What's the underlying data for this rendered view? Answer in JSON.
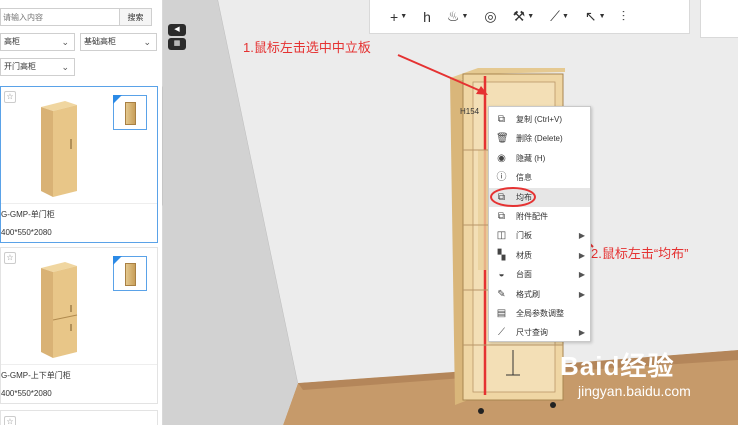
{
  "search": {
    "placeholder": "请输入内容",
    "button": "搜索"
  },
  "filters": {
    "category": "高柜",
    "subcategory": "基础高柜",
    "type": "开门高柜"
  },
  "products": [
    {
      "name": "G-GMP-单门柜",
      "size": "400*550*2080",
      "selected": true
    },
    {
      "name": "G-GMP-上下单门柜",
      "size": "400*550*2080",
      "selected": false
    }
  ],
  "side_tabs": [
    "◀",
    "▦"
  ],
  "toolbar": {
    "icons": [
      "plus-icon",
      "measure-icon",
      "paint-bucket-icon",
      "palette-icon",
      "roller-icon",
      "ruler-icon",
      "cursor-icon",
      "sliders-icon"
    ],
    "glyphs": [
      "+",
      "h",
      "♨",
      "◎",
      "⚒",
      "⟋",
      "↖",
      "⫶"
    ]
  },
  "annotations": {
    "step1": "1.鼠标左击选中中立板",
    "step2": "2.鼠标左击“均布”"
  },
  "cabinet_label": "154",
  "context_menu": [
    {
      "label": "复制 (Ctrl+V)",
      "icon": "copy-icon",
      "glyph": "⧉",
      "submenu": false
    },
    {
      "label": "删除 (Delete)",
      "icon": "trash-icon",
      "glyph": "🗑",
      "submenu": false
    },
    {
      "label": "隐藏 (H)",
      "icon": "eye-icon",
      "glyph": "◉",
      "submenu": false
    },
    {
      "label": "信息",
      "icon": "info-icon",
      "glyph": "ⓘ",
      "submenu": false
    },
    {
      "label": "均布",
      "icon": "distribute-icon",
      "glyph": "⧉",
      "submenu": false,
      "hover": true
    },
    {
      "label": "附件配件",
      "icon": "accessory-icon",
      "glyph": "⧉",
      "submenu": false
    },
    {
      "label": "门板",
      "icon": "door-icon",
      "glyph": "◫",
      "submenu": true
    },
    {
      "label": "材质",
      "icon": "material-icon",
      "glyph": "▚",
      "submenu": true
    },
    {
      "label": "台面",
      "icon": "countertop-icon",
      "glyph": "◒",
      "submenu": true
    },
    {
      "label": "格式刷",
      "icon": "brush-icon",
      "glyph": "✎",
      "submenu": true
    },
    {
      "label": "全局参数调整",
      "icon": "settings-doc-icon",
      "glyph": "▤",
      "submenu": false
    },
    {
      "label": "尺寸查询",
      "icon": "ruler-icon",
      "glyph": "⟋",
      "submenu": true
    }
  ],
  "watermark": {
    "brand": "Baid经验",
    "url": "jingyan.baidu.com"
  }
}
